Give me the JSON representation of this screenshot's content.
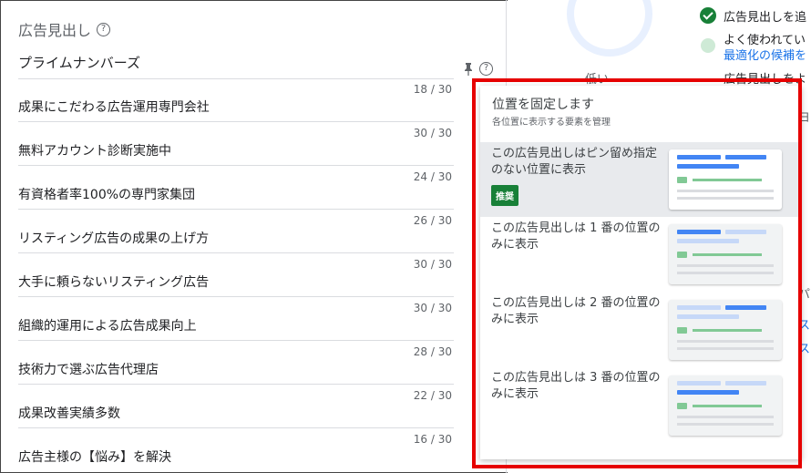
{
  "left": {
    "section_title": "広告見出し",
    "first_headline": "プライムナンバーズ",
    "rows": [
      {
        "count": "18 / 30",
        "text": "成果にこだわる広告運用専門会社"
      },
      {
        "count": "30 / 30",
        "text": "無料アカウント診断実施中"
      },
      {
        "count": "24 / 30",
        "text": "有資格者率100%の専門家集団"
      },
      {
        "count": "26 / 30",
        "text": "リスティング広告の成果の上げ方"
      },
      {
        "count": "30 / 30",
        "text": "大手に頼らないリスティング広告"
      },
      {
        "count": "30 / 30",
        "text": "組織的運用による広告成果向上"
      },
      {
        "count": "28 / 30",
        "text": "技術力で選ぶ広告代理店"
      },
      {
        "count": "22 / 30",
        "text": "成果改善実績多数"
      },
      {
        "count": "16 / 30",
        "text": "広告主様の【悩み】を解決"
      }
    ]
  },
  "right": {
    "low_label": "低い",
    "item1": "広告見出しを追",
    "item2": "よく使われてい",
    "item2_link": "最適化の候補を",
    "item3": "広告見出しをよ",
    "edge_1": "ヨ",
    "edge_2": "パ",
    "edge_3": "ス",
    "edge_4": "ス"
  },
  "popup": {
    "title": "位置を固定します",
    "subtitle": "各位置に表示する要素を管理",
    "options": [
      {
        "label": "この広告見出しはピン留め指定のない位置に表示",
        "badge": "推奨"
      },
      {
        "label": "この広告見出しは 1 番の位置のみに表示"
      },
      {
        "label": "この広告見出しは 2 番の位置のみに表示"
      },
      {
        "label": "この広告見出しは 3 番の位置のみに表示"
      }
    ]
  },
  "colors": {
    "highlight": "#e60000",
    "accent_blue": "#4285f4",
    "badge_green": "#188038"
  }
}
